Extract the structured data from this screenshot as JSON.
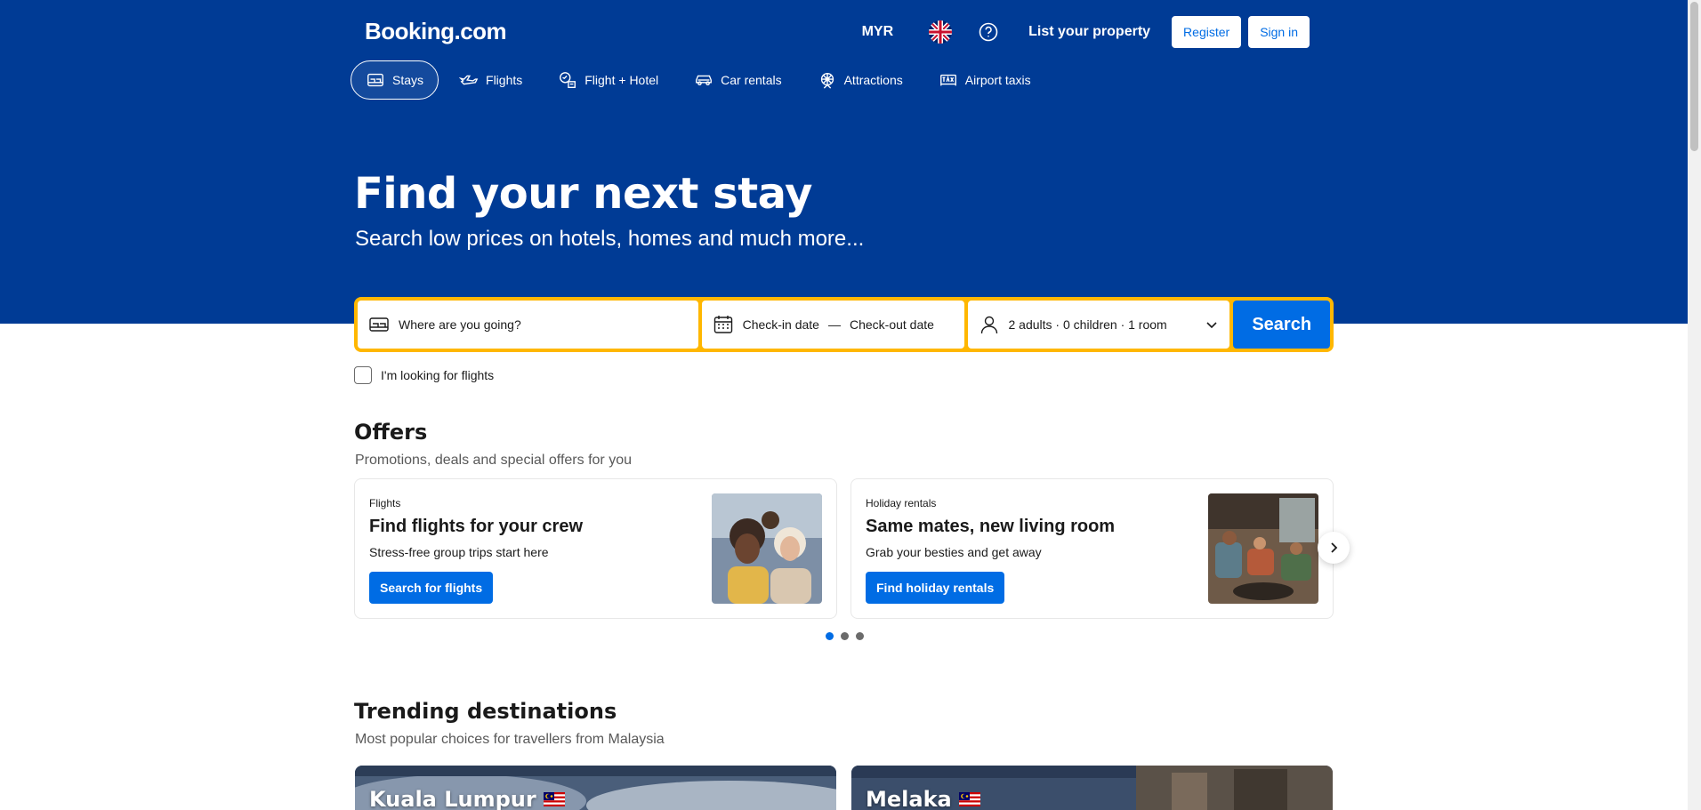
{
  "brand": {
    "logo_text": "Booking.com",
    "primary_color": "#003b95",
    "accent_color": "#006ce4",
    "search_border_color": "#ffb700"
  },
  "header": {
    "currency": "MYR",
    "language_icon": "uk-flag-icon",
    "help_icon": "question-circle-icon",
    "list_property": "List your property",
    "register": "Register",
    "sign_in": "Sign in"
  },
  "nav": {
    "tabs": [
      {
        "label": "Stays",
        "icon": "bed-icon",
        "active": true
      },
      {
        "label": "Flights",
        "icon": "plane-icon"
      },
      {
        "label": "Flight + Hotel",
        "icon": "flight-hotel-icon"
      },
      {
        "label": "Car rentals",
        "icon": "car-icon"
      },
      {
        "label": "Attractions",
        "icon": "attractions-icon"
      },
      {
        "label": "Airport taxis",
        "icon": "taxi-icon"
      }
    ]
  },
  "hero": {
    "title": "Find your next stay",
    "subtitle": "Search low prices on hotels, homes and much more..."
  },
  "search": {
    "destination_placeholder": "Where are you going?",
    "checkin": "Check-in date",
    "separator": "—",
    "checkout": "Check-out date",
    "guests": "2 adults · 0 children · 1 room",
    "button": "Search",
    "flights_checkbox_label": "I'm looking for flights"
  },
  "offers": {
    "title": "Offers",
    "subtitle": "Promotions, deals and special offers for you",
    "cards": [
      {
        "eyebrow": "Flights",
        "title": "Find flights for your crew",
        "desc": "Stress-free group trips start here",
        "cta": "Search for flights"
      },
      {
        "eyebrow": "Holiday rentals",
        "title": "Same mates, new living room",
        "desc": "Grab your besties and get away",
        "cta": "Find holiday rentals"
      }
    ],
    "page_count": 3,
    "active_page": 1
  },
  "trending": {
    "title": "Trending destinations",
    "subtitle": "Most popular choices for travellers from Malaysia",
    "destinations": [
      {
        "name": "Kuala Lumpur",
        "flag": "malaysia-flag-icon"
      },
      {
        "name": "Melaka",
        "flag": "malaysia-flag-icon"
      }
    ]
  }
}
